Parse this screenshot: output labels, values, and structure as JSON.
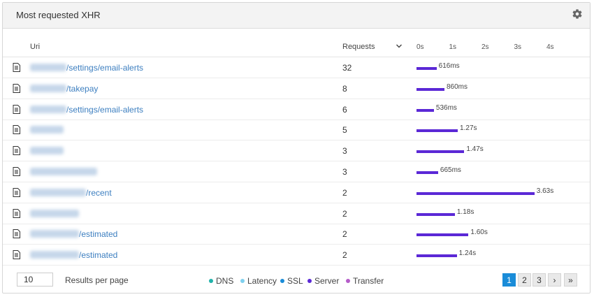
{
  "panel": {
    "title": "Most requested XHR"
  },
  "table": {
    "columns": {
      "uri": "Uri",
      "requests": "Requests"
    },
    "time_ticks": [
      "0s",
      "1s",
      "2s",
      "3s",
      "4s"
    ],
    "time_axis_max_s": 4,
    "rows": [
      {
        "uri_suffix": "/settings/email-alerts",
        "requests": "32",
        "duration": "616ms",
        "duration_s": 0.616
      },
      {
        "uri_suffix": "/takepay",
        "requests": "8",
        "duration": "860ms",
        "duration_s": 0.86
      },
      {
        "uri_suffix": "/settings/email-alerts",
        "requests": "6",
        "duration": "536ms",
        "duration_s": 0.536
      },
      {
        "uri_suffix": "",
        "requests": "5",
        "duration": "1.27s",
        "duration_s": 1.27
      },
      {
        "uri_suffix": "",
        "requests": "3",
        "duration": "1.47s",
        "duration_s": 1.47
      },
      {
        "uri_suffix": "",
        "requests": "3",
        "duration": "665ms",
        "duration_s": 0.665
      },
      {
        "uri_suffix": "/recent",
        "requests": "2",
        "duration": "3.63s",
        "duration_s": 3.63
      },
      {
        "uri_suffix": "",
        "requests": "2",
        "duration": "1.18s",
        "duration_s": 1.18
      },
      {
        "uri_suffix": "/estimated",
        "requests": "2",
        "duration": "1.60s",
        "duration_s": 1.6
      },
      {
        "uri_suffix": "/estimated",
        "requests": "2",
        "duration": "1.24s",
        "duration_s": 1.24
      }
    ]
  },
  "footer": {
    "per_page_value": "10",
    "per_page_label": "Results per page",
    "legend": [
      {
        "label": "DNS",
        "color": "#20b2aa"
      },
      {
        "label": "Latency",
        "color": "#7fd0ef"
      },
      {
        "label": "SSL",
        "color": "#1a8cd8"
      },
      {
        "label": "Server",
        "color": "#5b28d6"
      },
      {
        "label": "Transfer",
        "color": "#b55cc9"
      }
    ],
    "pagination": {
      "pages": [
        "1",
        "2",
        "3"
      ],
      "current": "1",
      "next": "›",
      "last": "»"
    }
  },
  "colors": {
    "accent": "#1a8cd8",
    "bar": "#5b28d6",
    "link": "#3d7fc0"
  }
}
